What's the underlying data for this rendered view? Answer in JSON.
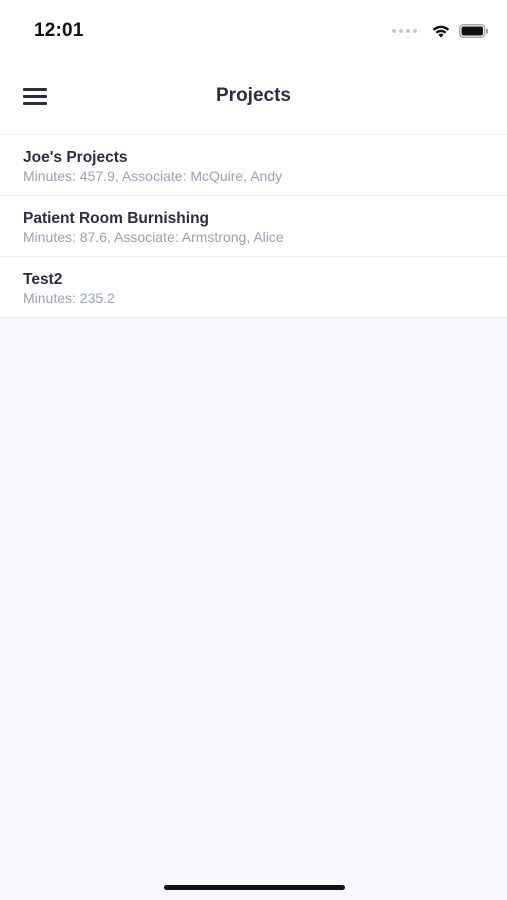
{
  "status_bar": {
    "time": "12:01",
    "icons": [
      "signal-dots-icon",
      "wifi-icon",
      "battery-icon"
    ]
  },
  "nav": {
    "title": "Projects",
    "menu_icon": "hamburger-menu-icon"
  },
  "projects": [
    {
      "name": "Joe's Projects",
      "detail": "Minutes: 457.9, Associate: McQuire, Andy"
    },
    {
      "name": "Patient Room Burnishing",
      "detail": "Minutes: 87.6, Associate: Armstrong, Alice"
    },
    {
      "name": "Test2",
      "detail": "Minutes: 235.2"
    }
  ],
  "colors": {
    "background": "#f6f8fc",
    "surface": "#ffffff",
    "title_text": "#2b2e42",
    "secondary_text": "#9aa1b5"
  }
}
